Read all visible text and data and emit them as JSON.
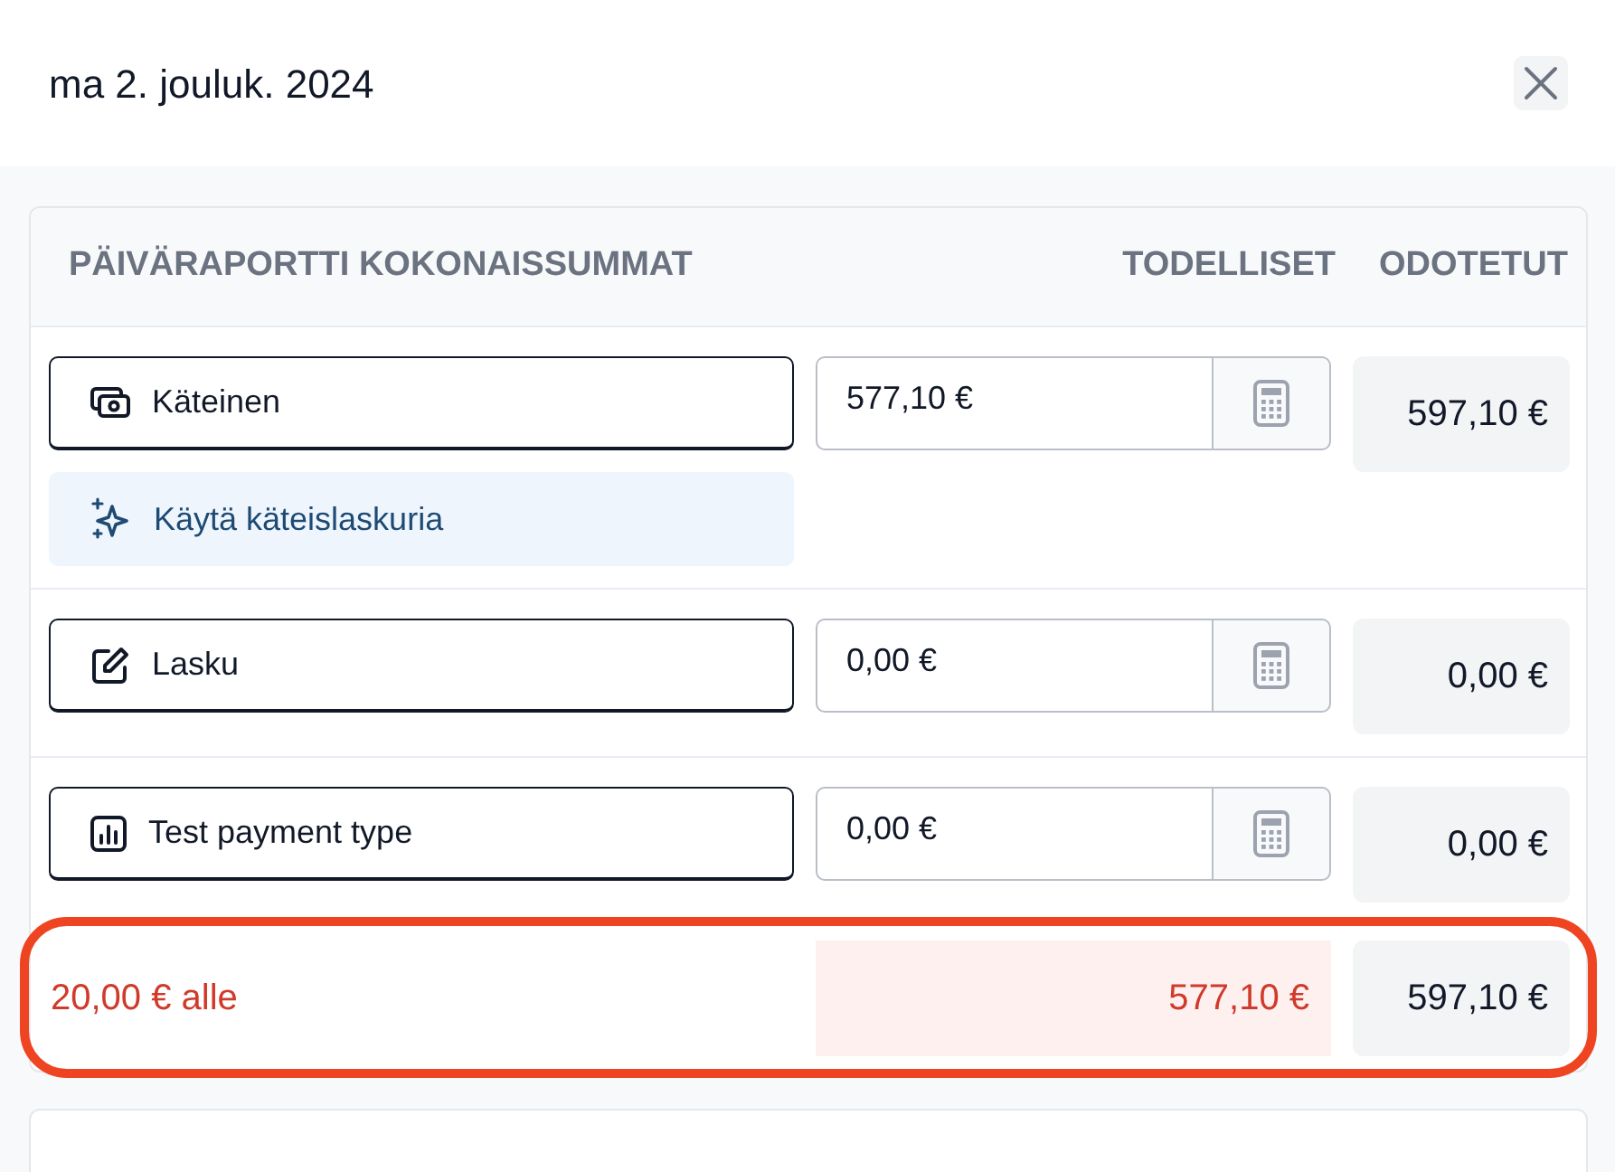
{
  "header": {
    "date": "ma 2. jouluk. 2024"
  },
  "totals_card": {
    "title": "PÄIVÄRAPORTTI KOKONAISSUMMAT",
    "columns": [
      "TODELLISET",
      "ODOTETUT"
    ],
    "payment_rows": [
      {
        "kind": "cash",
        "label": "Käteinen",
        "actual": "577,10 €",
        "expected": "597,10 €",
        "helper_button": "Käytä käteislaskuria"
      },
      {
        "kind": "invoice",
        "label": "Lasku",
        "actual": "0,00 €",
        "expected": "0,00 €"
      },
      {
        "kind": "chart",
        "label": "Test payment type",
        "actual": "0,00 €",
        "expected": "0,00 €"
      }
    ],
    "summary": {
      "difference": "20,00 € alle",
      "actual": "577,10 €",
      "expected": "597,10 €",
      "highlighted": true
    }
  }
}
